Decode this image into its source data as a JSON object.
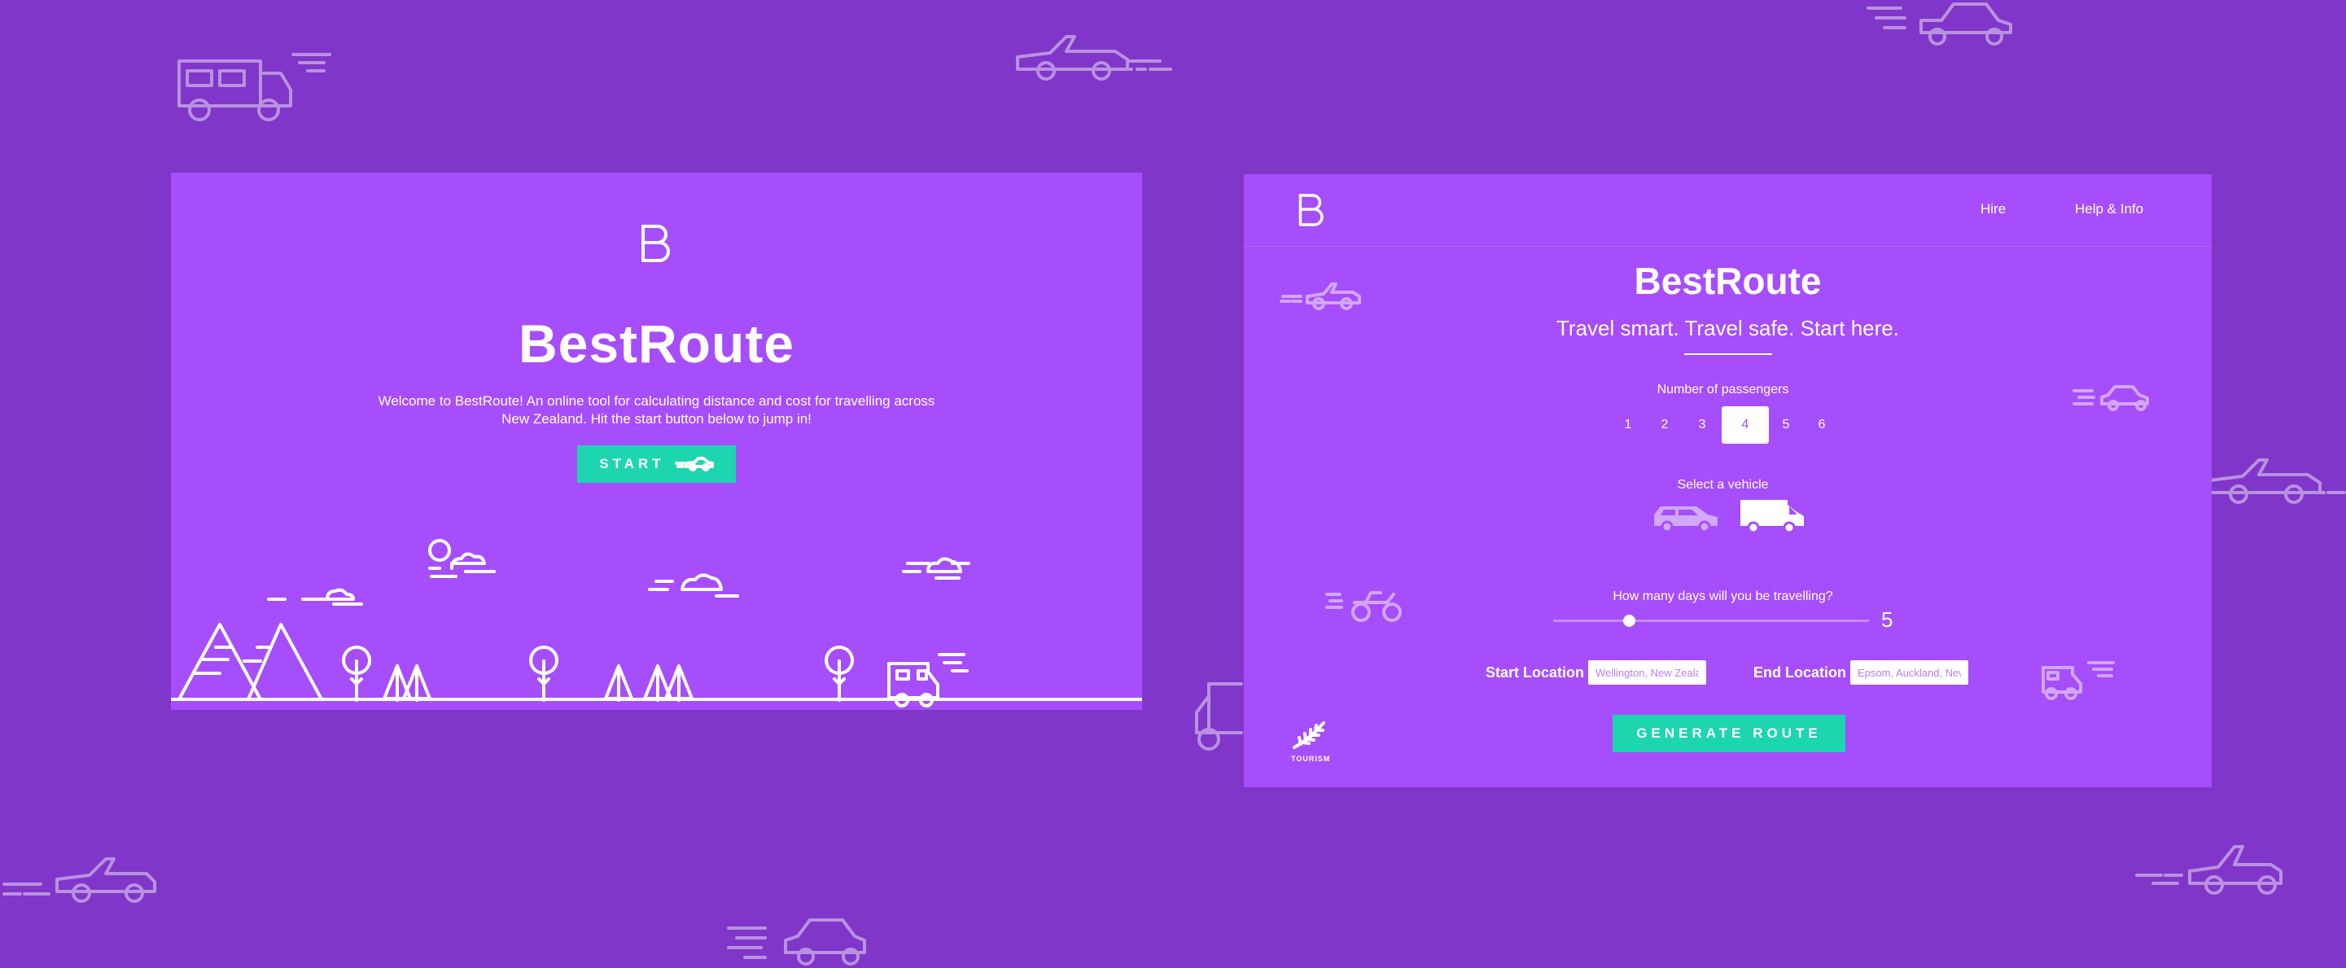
{
  "brand": "BestRoute",
  "landing": {
    "title": "BestRoute",
    "intro": "Welcome to BestRoute! An online tool for calculating distance and cost for travelling across New Zealand. Hit the start button below to jump in!",
    "start_label": "START"
  },
  "planner": {
    "nav": [
      "Hire",
      "Help & Info"
    ],
    "title": "BestRoute",
    "tagline": "Travel smart. Travel safe. Start here.",
    "passengers_label": "Number of passengers",
    "passenger_options": [
      "1",
      "2",
      "3",
      "4",
      "5",
      "6"
    ],
    "passengers_selected": "4",
    "vehicle_label": "Select a vehicle",
    "vehicles": [
      "car-icon",
      "campervan-icon"
    ],
    "vehicle_selected": "campervan-icon",
    "days_label": "How many days will you be travelling?",
    "days_value": "5",
    "start_label": "Start Location",
    "start_placeholder": "Wellington, New Zealand",
    "end_label": "End Location",
    "end_placeholder": "Epsom, Auckland, New Zealand",
    "generate_label": "GENERATE ROUTE",
    "badge_text": "TOURISM"
  },
  "colors": {
    "background": "#8036c9",
    "panel": "#a64dfc",
    "accent": "#1dd6b0",
    "text": "#ffffff"
  }
}
